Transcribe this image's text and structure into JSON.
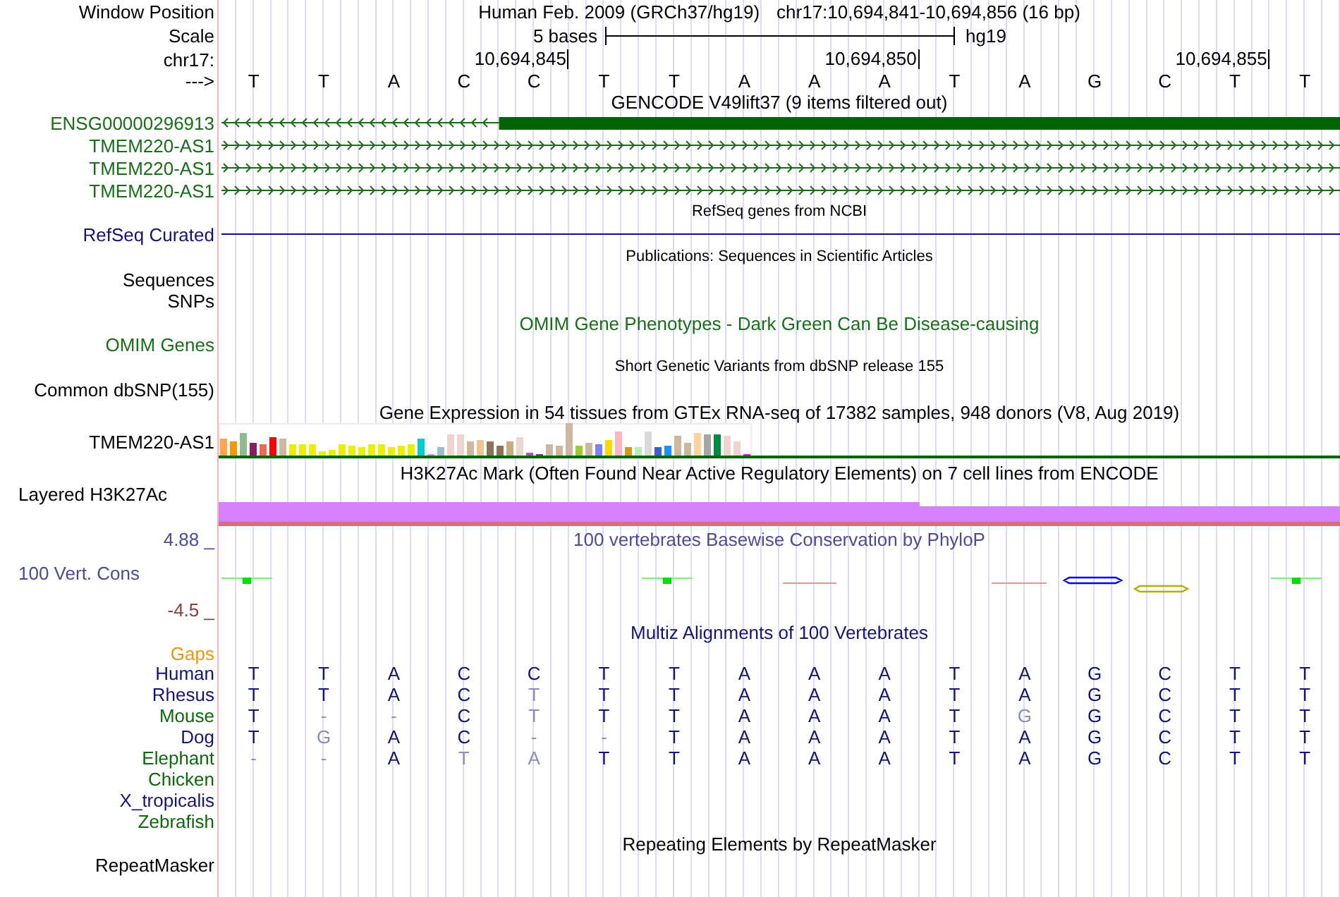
{
  "position": {
    "label": "Window Position",
    "assembly": "Human Feb. 2009 (GRCh37/hg19)",
    "range": "chr17:10,694,841-10,694,856 (16 bp)"
  },
  "scale": {
    "label": "Scale",
    "length": "5 bases",
    "assembly": "hg19"
  },
  "coordinates": {
    "label": "chr17:",
    "ticks": [
      "10,694,845",
      "10,694,850",
      "10,694,855"
    ]
  },
  "sequence": {
    "label": "--->",
    "bases": [
      "T",
      "T",
      "A",
      "C",
      "C",
      "T",
      "T",
      "A",
      "A",
      "A",
      "T",
      "A",
      "G",
      "C",
      "T",
      "T"
    ]
  },
  "gencode": {
    "title": "GENCODE V49lift37 (9 items filtered out)",
    "transcripts": [
      {
        "name": "ENSG00000296913",
        "reverse": true,
        "exon": true
      },
      {
        "name": "TMEM220-AS1",
        "reverse": false,
        "exon": false
      },
      {
        "name": "TMEM220-AS1",
        "reverse": false,
        "exon": false
      },
      {
        "name": "TMEM220-AS1",
        "reverse": false,
        "exon": false
      }
    ]
  },
  "refseq": {
    "title": "RefSeq genes from NCBI",
    "label": "RefSeq Curated"
  },
  "publications": {
    "title": "Publications: Sequences in Scientific Articles",
    "labels": [
      "Sequences",
      "SNPs"
    ]
  },
  "omim": {
    "title": "OMIM Gene Phenotypes - Dark Green Can Be Disease-causing",
    "label": "OMIM Genes"
  },
  "dbsnp": {
    "title": "Short Genetic Variants from dbSNP release 155",
    "label": "Common dbSNP(155)"
  },
  "gtex": {
    "title": "Gene Expression in 54 tissues from GTEx RNA-seq of 17382 samples, 948 donors (V8, Aug 2019)",
    "label": "TMEM220-AS1"
  },
  "h3k27ac": {
    "title": "H3K27Ac Mark (Often Found Near Active Regulatory Elements) on 7 cell lines from ENCODE",
    "label": "Layered H3K27Ac"
  },
  "phylop": {
    "title": "100 vertebrates Basewise Conservation by PhyloP",
    "label": "100 Vert. Cons",
    "max_label": "4.88 _",
    "min_label": "-4.5 _"
  },
  "multiz": {
    "title": "Multiz Alignments of 100 Vertebrates",
    "gaps_label": "Gaps",
    "species": [
      {
        "name": "Human",
        "color": "#141478",
        "bases": [
          {
            "base": "T",
            "differs": false
          },
          {
            "base": "T",
            "differs": false
          },
          {
            "base": "A",
            "differs": false
          },
          {
            "base": "C",
            "differs": false
          },
          {
            "base": "C",
            "differs": false
          },
          {
            "base": "T",
            "differs": false
          },
          {
            "base": "T",
            "differs": false
          },
          {
            "base": "A",
            "differs": false
          },
          {
            "base": "A",
            "differs": false
          },
          {
            "base": "A",
            "differs": false
          },
          {
            "base": "T",
            "differs": false
          },
          {
            "base": "A",
            "differs": false
          },
          {
            "base": "G",
            "differs": false
          },
          {
            "base": "C",
            "differs": false
          },
          {
            "base": "T",
            "differs": false
          },
          {
            "base": "T",
            "differs": false
          }
        ]
      },
      {
        "name": "Rhesus",
        "color": "#141478",
        "bases": [
          {
            "base": "T",
            "differs": false
          },
          {
            "base": "T",
            "differs": false
          },
          {
            "base": "A",
            "differs": false
          },
          {
            "base": "C",
            "differs": false
          },
          {
            "base": "T",
            "differs": true
          },
          {
            "base": "T",
            "differs": false
          },
          {
            "base": "T",
            "differs": false
          },
          {
            "base": "A",
            "differs": false
          },
          {
            "base": "A",
            "differs": false
          },
          {
            "base": "A",
            "differs": false
          },
          {
            "base": "T",
            "differs": false
          },
          {
            "base": "A",
            "differs": false
          },
          {
            "base": "G",
            "differs": false
          },
          {
            "base": "C",
            "differs": false
          },
          {
            "base": "T",
            "differs": false
          },
          {
            "base": "T",
            "differs": false
          }
        ]
      },
      {
        "name": "Mouse",
        "color": "#0b6b0b",
        "bases": [
          {
            "base": "T",
            "differs": false
          },
          {
            "base": "-",
            "differs": true
          },
          {
            "base": "-",
            "differs": true
          },
          {
            "base": "C",
            "differs": false
          },
          {
            "base": "T",
            "differs": true
          },
          {
            "base": "T",
            "differs": false
          },
          {
            "base": "T",
            "differs": false
          },
          {
            "base": "A",
            "differs": false
          },
          {
            "base": "A",
            "differs": false
          },
          {
            "base": "A",
            "differs": false
          },
          {
            "base": "T",
            "differs": false
          },
          {
            "base": "G",
            "differs": true
          },
          {
            "base": "G",
            "differs": false
          },
          {
            "base": "C",
            "differs": false
          },
          {
            "base": "T",
            "differs": false
          },
          {
            "base": "T",
            "differs": false
          }
        ]
      },
      {
        "name": "Dog",
        "color": "#141478",
        "bases": [
          {
            "base": "T",
            "differs": false
          },
          {
            "base": "G",
            "differs": true
          },
          {
            "base": "A",
            "differs": false
          },
          {
            "base": "C",
            "differs": false
          },
          {
            "base": "-",
            "differs": true
          },
          {
            "base": "-",
            "differs": true
          },
          {
            "base": "T",
            "differs": false
          },
          {
            "base": "A",
            "differs": false
          },
          {
            "base": "A",
            "differs": false
          },
          {
            "base": "A",
            "differs": false
          },
          {
            "base": "T",
            "differs": false
          },
          {
            "base": "A",
            "differs": false
          },
          {
            "base": "G",
            "differs": false
          },
          {
            "base": "C",
            "differs": false
          },
          {
            "base": "T",
            "differs": false
          },
          {
            "base": "T",
            "differs": false
          }
        ]
      },
      {
        "name": "Elephant",
        "color": "#0b6b0b",
        "bases": [
          {
            "base": "-",
            "differs": true
          },
          {
            "base": "-",
            "differs": true
          },
          {
            "base": "A",
            "differs": false
          },
          {
            "base": "T",
            "differs": true
          },
          {
            "base": "A",
            "differs": true
          },
          {
            "base": "T",
            "differs": false
          },
          {
            "base": "T",
            "differs": false
          },
          {
            "base": "A",
            "differs": false
          },
          {
            "base": "A",
            "differs": false
          },
          {
            "base": "A",
            "differs": false
          },
          {
            "base": "T",
            "differs": false
          },
          {
            "base": "A",
            "differs": false
          },
          {
            "base": "G",
            "differs": false
          },
          {
            "base": "C",
            "differs": false
          },
          {
            "base": "T",
            "differs": false
          },
          {
            "base": "T",
            "differs": false
          }
        ]
      },
      {
        "name": "Chicken",
        "color": "#0b6b0b"
      },
      {
        "name": "X_tropicalis",
        "color": "#141478"
      },
      {
        "name": "Zebrafish",
        "color": "#0b6b0b"
      }
    ]
  },
  "repeatmasker": {
    "title": "Repeating Elements by RepeatMasker",
    "label": "RepeatMasker"
  }
}
